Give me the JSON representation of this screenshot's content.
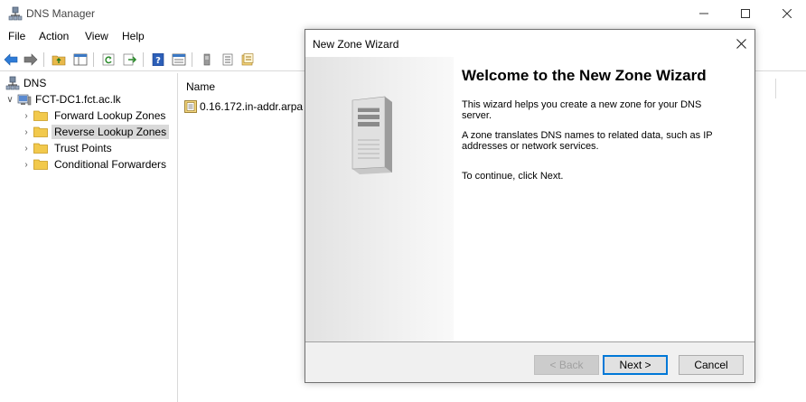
{
  "window": {
    "title": "DNS Manager"
  },
  "menu": {
    "file": "File",
    "action": "Action",
    "view": "View",
    "help": "Help"
  },
  "tree": {
    "root": "DNS",
    "server": "FCT-DC1.fct.ac.lk",
    "items": [
      {
        "label": "Forward Lookup Zones"
      },
      {
        "label": "Reverse Lookup Zones"
      },
      {
        "label": "Trust Points"
      },
      {
        "label": "Conditional Forwarders"
      }
    ]
  },
  "list": {
    "column_name": "Name",
    "rows": [
      {
        "name": "0.16.172.in-addr.arpa"
      }
    ]
  },
  "dialog": {
    "title": "New Zone Wizard",
    "heading": "Welcome to the New Zone Wizard",
    "para1": "This wizard helps you create a new zone for your DNS server.",
    "para2": "A zone translates DNS names to related data, such as IP addresses or network services.",
    "para3": "To continue, click Next.",
    "back_label": "< Back",
    "next_label": "Next >",
    "cancel_label": "Cancel"
  },
  "colors": {
    "accent": "#0078d7",
    "selection": "#d9d9d9",
    "folder": "#f2c94c"
  }
}
